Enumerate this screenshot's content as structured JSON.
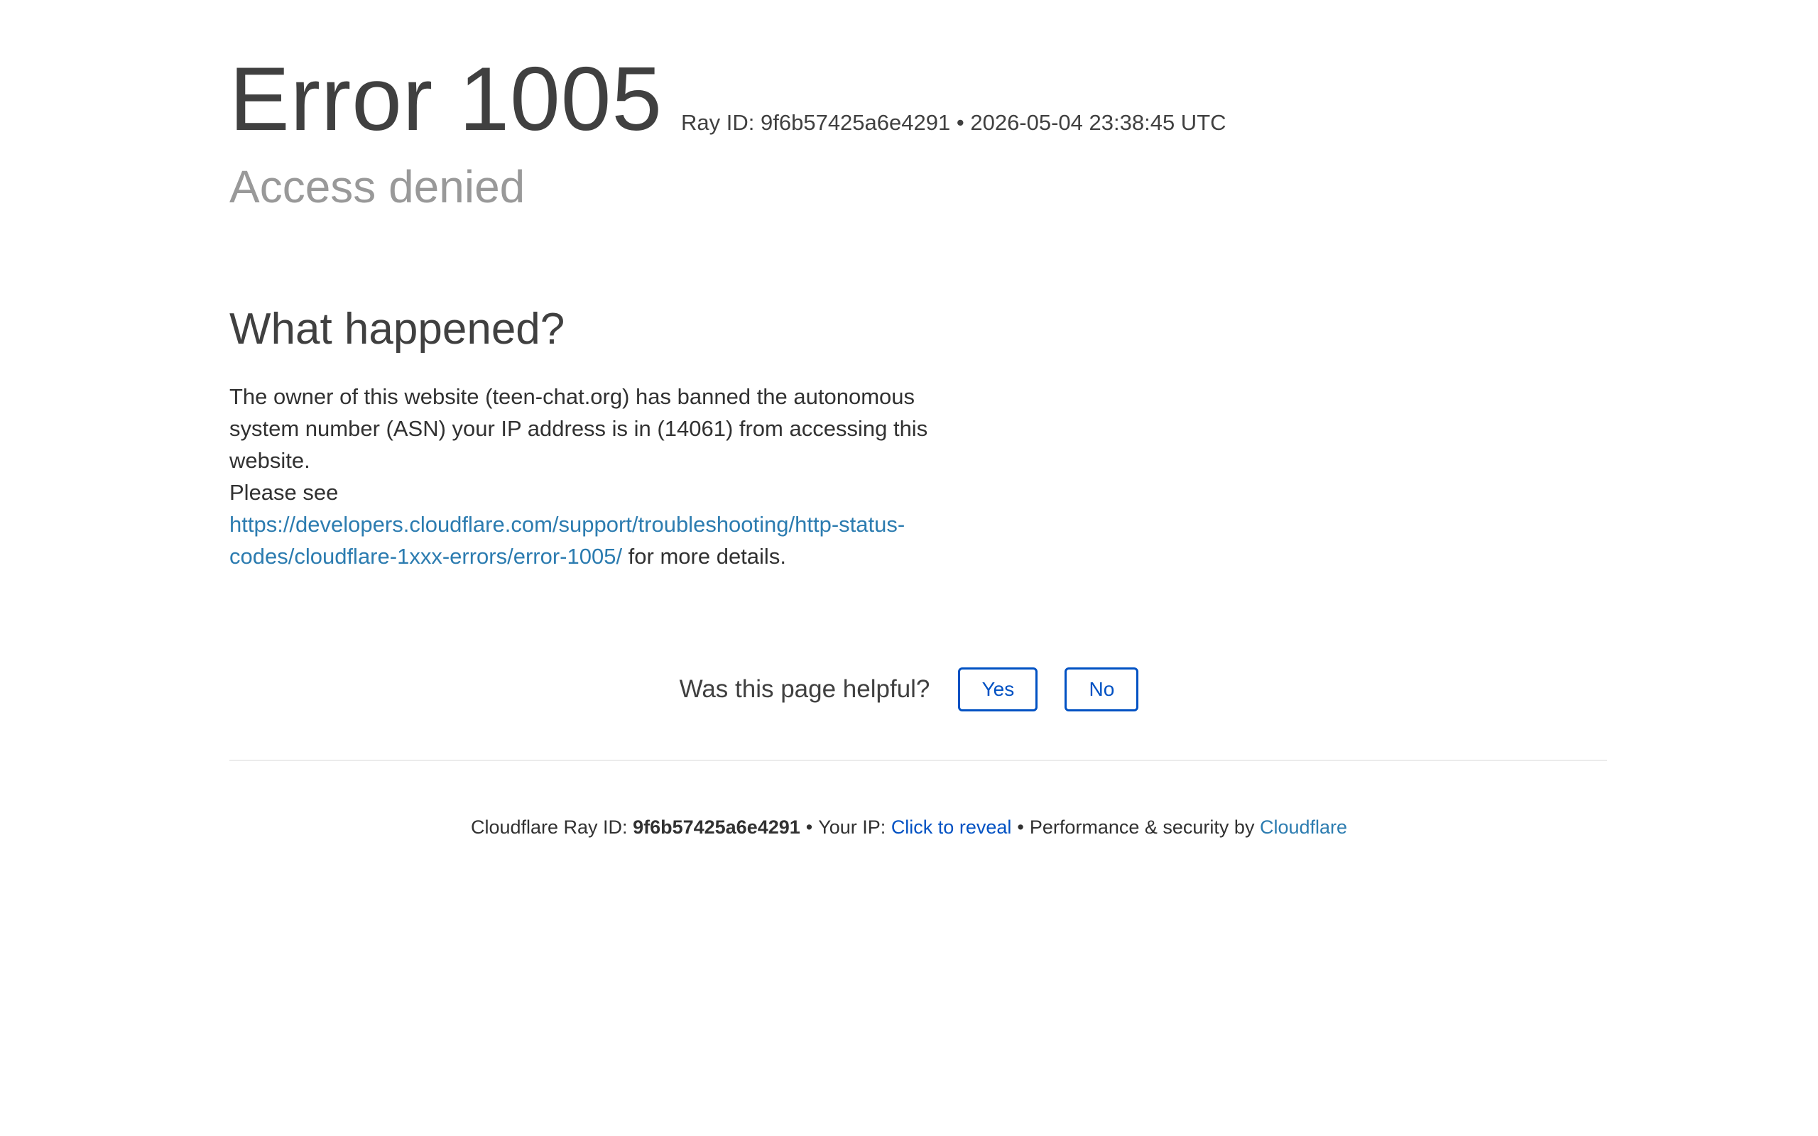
{
  "header": {
    "title": "Error 1005",
    "ray_prefix": "Ray ID: ",
    "ray_id": "9f6b57425a6e4291",
    "separator": "•",
    "timestamp": "2026-05-04 23:38:45 UTC"
  },
  "subtitle": "Access denied",
  "section": {
    "title": "What happened?",
    "description": "The owner of this website (teen-chat.org) has banned the autonomous system number (ASN) your IP address is in (14061) from accessing this website.",
    "please_see": "Please see",
    "link_text": "https://developers.cloudflare.com/support/troubleshooting/http-status-codes/cloudflare-1xxx-errors/error-1005/",
    "after_link": " for more details."
  },
  "feedback": {
    "question": "Was this page helpful?",
    "yes_label": "Yes",
    "no_label": "No"
  },
  "footer": {
    "ray_label": "Cloudflare Ray ID: ",
    "ray_id": "9f6b57425a6e4291",
    "separator": "•",
    "ip_label": "Your IP: ",
    "ip_reveal": "Click to reveal",
    "perf_label": "Performance & security by ",
    "cloudflare_link": "Cloudflare"
  },
  "colors": {
    "link": "#2c7cb0",
    "button": "#0051c3",
    "muted": "#999999"
  }
}
